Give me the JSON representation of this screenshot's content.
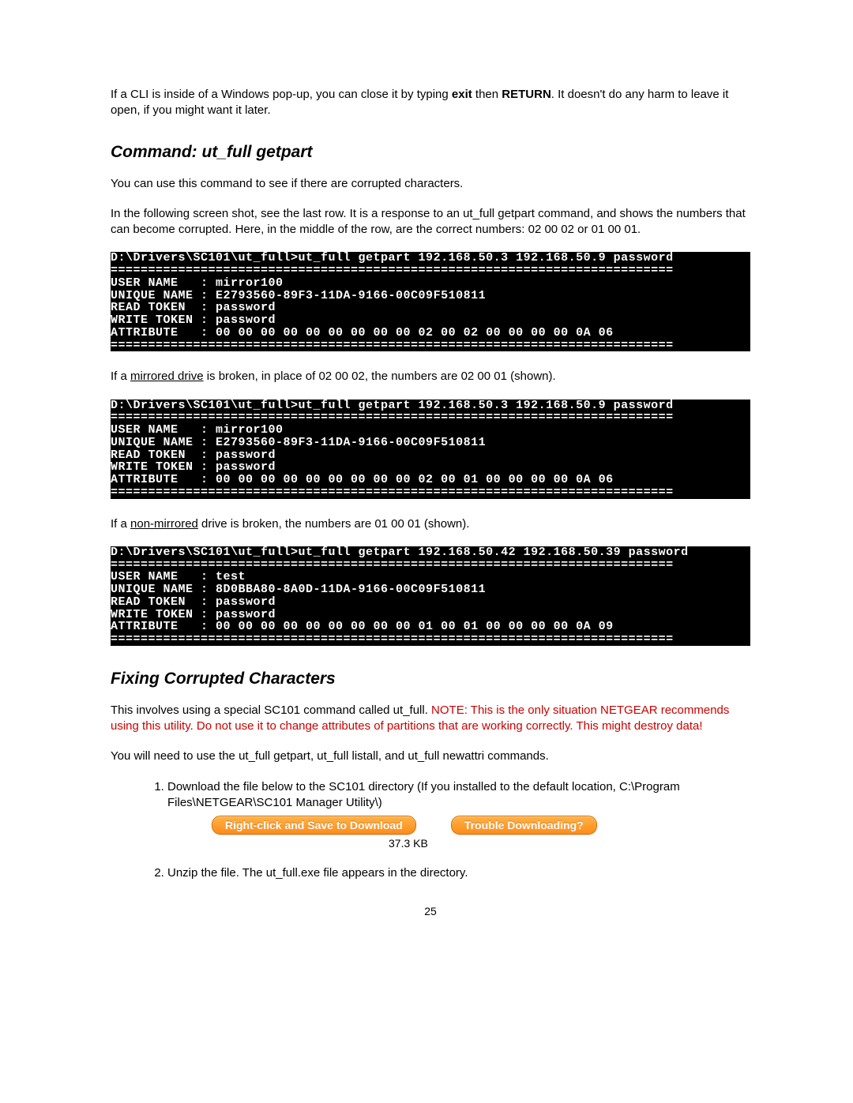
{
  "intro": {
    "pre": "If a CLI is inside of a Windows pop-up, you can close it by typing ",
    "exit_bold": "exit",
    "mid": " then ",
    "return_bold": "RETURN",
    "post": ". It doesn't do any harm to leave it open, if you might want it later."
  },
  "section1": {
    "heading": "Command: ut_full getpart",
    "p1": "You can use this command to see if there are corrupted characters.",
    "p2": "In the following screen shot, see the last row. It is a response to an ut_full getpart command, and shows the numbers that can become corrupted. Here, in the middle of the row, are the correct numbers: 02 00 02 or 01 00 01.",
    "term1": "D:\\Drivers\\SC101\\ut_full>ut_full getpart 192.168.50.3 192.168.50.9 password\n===========================================================================\nUSER NAME   : mirror100\nUNIQUE NAME : E2793560-89F3-11DA-9166-00C09F510811\nREAD TOKEN  : password\nWRITE TOKEN : password\nATTRIBUTE   : 00 00 00 00 00 00 00 00 00 02 00 02 00 00 00 00 0A 06\n===========================================================================",
    "p3_pre": "If a ",
    "p3_u": "mirrored drive",
    "p3_post": " is broken, in place of 02 00 02, the numbers are 02 00 01 (shown).",
    "term2": "D:\\Drivers\\SC101\\ut_full>ut_full getpart 192.168.50.3 192.168.50.9 password\n===========================================================================\nUSER NAME   : mirror100\nUNIQUE NAME : E2793560-89F3-11DA-9166-00C09F510811\nREAD TOKEN  : password\nWRITE TOKEN : password\nATTRIBUTE   : 00 00 00 00 00 00 00 00 00 02 00 01 00 00 00 00 0A 06\n===========================================================================",
    "p4_pre": "If a ",
    "p4_u": "non-mirrored",
    "p4_post": " drive is broken, the numbers are 01 00 01 (shown).",
    "term3": "D:\\Drivers\\SC101\\ut_full>ut_full getpart 192.168.50.42 192.168.50.39 password\n===========================================================================\nUSER NAME   : test\nUNIQUE NAME : 8D0BBA80-8A0D-11DA-9166-00C09F510811\nREAD TOKEN  : password\nWRITE TOKEN : password\nATTRIBUTE   : 00 00 00 00 00 00 00 00 00 01 00 01 00 00 00 00 0A 09\n==========================================================================="
  },
  "section2": {
    "heading": "Fixing Corrupted Characters",
    "p1_pre": "This involves using a special SC101 command called ut_full. ",
    "p1_red": "NOTE: This is the only situation NETGEAR recommends using this utility. Do not use it to change attributes of partitions that are working correctly. This might destroy data!",
    "p2": "You will need to use the ut_full getpart, ut_full listall, and ut_full newattri commands.",
    "step1": "Download the file below to the SC101 directory (If you installed to the default location, C:\\Program Files\\NETGEAR\\SC101 Manager Utility\\)",
    "btn_download": "Right-click and Save to Download",
    "btn_trouble": "Trouble Downloading?",
    "filesize": "37.3 KB",
    "step2": "Unzip the file. The ut_full.exe file appears in the directory."
  },
  "page_number": "25"
}
